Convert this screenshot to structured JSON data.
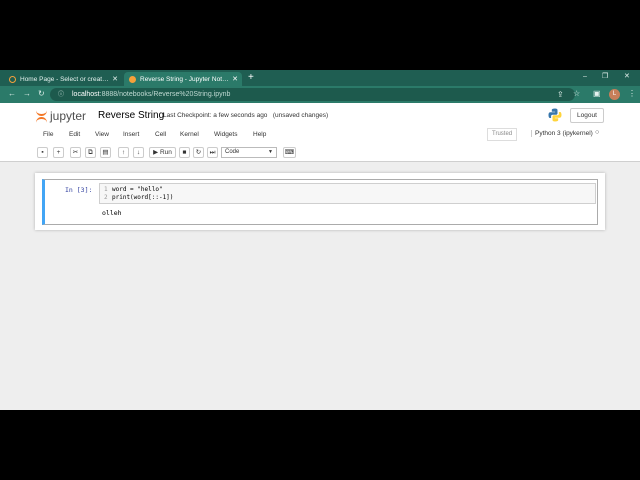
{
  "browser": {
    "tabs": [
      {
        "label": "Home Page - Select or create a n",
        "active": false
      },
      {
        "label": "Reverse String - Jupyter Notebook",
        "active": true
      }
    ],
    "new_tab": "+",
    "window_controls": {
      "minimize": "–",
      "restore": "❐",
      "close": "✕"
    },
    "nav": {
      "back": "←",
      "forward": "→",
      "reload": "↻"
    },
    "url_host": "localhost",
    "url_path": ":8888/notebooks/Reverse%20String.ipynb",
    "profile_initial": "L"
  },
  "jupyter": {
    "logo_text": "jupyter",
    "notebook_name": "Reverse String",
    "checkpoint": "Last Checkpoint: a few seconds ago",
    "unsaved": "(unsaved changes)",
    "logout": "Logout",
    "menu": [
      "File",
      "Edit",
      "View",
      "Insert",
      "Cell",
      "Kernel",
      "Widgets",
      "Help"
    ],
    "trusted": "Trusted",
    "kernel": "Python 3 (ipykernel)",
    "toolbar": {
      "run_label": "Run",
      "cell_type": "Code"
    }
  },
  "cell": {
    "prompt": "In [3]:",
    "lines": [
      {
        "no": "1",
        "code": "word = \"hello\""
      },
      {
        "no": "2",
        "code": "print(word[::-1])"
      }
    ],
    "output": "olleh"
  },
  "colors": {
    "tab_bar": "#1f5e52",
    "nav_bar": "#2b7a69",
    "jupyter_orange": "#f37726",
    "cell_selected_border": "#42a5f5"
  }
}
